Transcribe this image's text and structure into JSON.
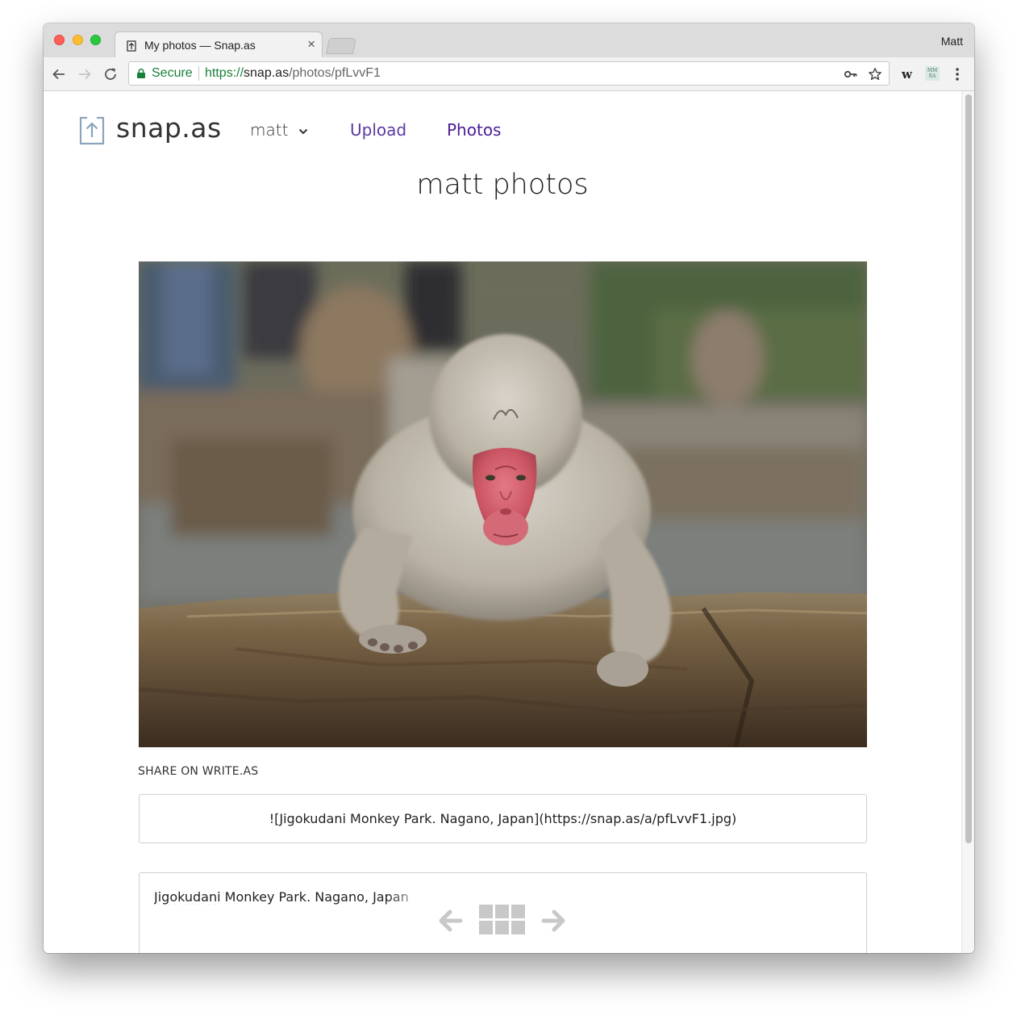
{
  "browser": {
    "tab_title": "My photos — Snap.as",
    "tab_close": "×",
    "profile_name": "Matt",
    "secure_label": "Secure",
    "url_scheme": "https://",
    "url_host": "snap.as",
    "url_path": "/photos/pfLvvF1",
    "extension_w_label": "w",
    "extension_badge_line1": "MM",
    "extension_badge_line2": "RA",
    "colors": {
      "secure_green": "#188038",
      "tab_bar": "#dcdcdc",
      "toolbar": "#f2f2f2"
    }
  },
  "site": {
    "logo_text": "snap.as",
    "user_menu_label": "matt",
    "nav": {
      "upload": "Upload",
      "photos": "Photos"
    },
    "colors": {
      "nav_link": "#5a3aa1",
      "nav_active": "#4a1d96"
    }
  },
  "main": {
    "page_title": "matt photos",
    "photo": {
      "subject": "Japanese macaque (snow monkey) resting on a rock at a hot spring"
    },
    "share_label": "SHARE ON WRITE.AS",
    "embed_markdown": "![Jigokudani Monkey Park. Nagano, Japan](https://snap.as/a/pfLvvF1.jpg)",
    "caption": {
      "misspelled_word": "Jigokudani",
      "rest": " Monkey Park. Nagano, Japan"
    }
  },
  "icons": {
    "back": "arrow-left-icon",
    "forward": "arrow-right-icon",
    "reload": "reload-icon",
    "lock": "lock-icon",
    "key": "key-icon",
    "star": "star-icon",
    "menu": "kebab-menu-icon",
    "upload_logo": "upload-box-icon",
    "chevron": "chevron-down-icon",
    "pager_prev": "arrow-left-icon",
    "pager_grid": "grid-icon",
    "pager_next": "arrow-right-icon"
  }
}
